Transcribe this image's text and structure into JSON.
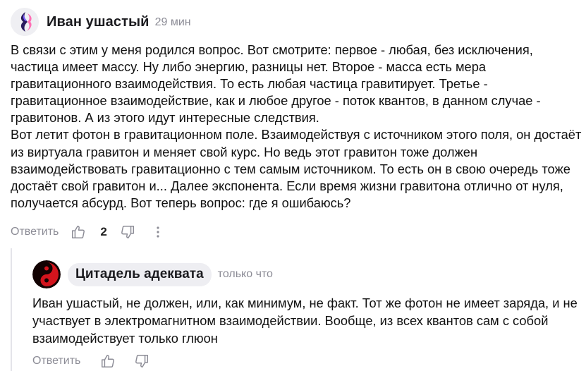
{
  "comment": {
    "author": "Иван ушастый",
    "time": "29 мин",
    "text": "В связи с этим у меня родился вопрос. Вот смотрите: первое - любая, без исключения, частица имеет массу. Ну либо энергию, разницы нет. Второе - масса есть мера гравитационного взаимодействия. То есть любая частица гравитирует. Третье - гравитационное взаимодействие, как и любое другое - поток квантов, в данном случае - гравитонов. А из этого идут интересные следствия.\nВот летит фотон в гравитационном поле. Взаимодействуя с источником этого поля, он достаёт из виртуала гравитон и меняет свой курс. Но ведь этот гравитон тоже должен взаимодействовать гравитационно с тем самым источником. То есть он в свою очередь тоже достаёт свой гравитон и... Далее экспонента. Если время жизни гравитона отлично от нуля, получается абсурд. Вот теперь вопрос: где я ошибаюсь?",
    "reply_label": "Ответить",
    "likes": "2"
  },
  "reply": {
    "author": "Цитадель адеквата",
    "time": "только что",
    "text": "Иван ушастый, не должен, или, как минимум, не факт. Тот же фотон не имеет заряда, и не участвует в электромагнитном взаимодействии. Вообще, из всех квантов сам с собой взаимодействует только глюон",
    "reply_label": "Ответить"
  },
  "icons": {
    "like": "thumbs-up-icon",
    "dislike": "thumbs-down-icon",
    "more": "more-vertical-icon"
  },
  "colors": {
    "muted": "#8c8c96",
    "chip": "#eeeef2",
    "avatar1_accent": "#7b5cff",
    "avatar1_pink": "#ff6fb5",
    "avatar2_red": "#d3141d"
  }
}
